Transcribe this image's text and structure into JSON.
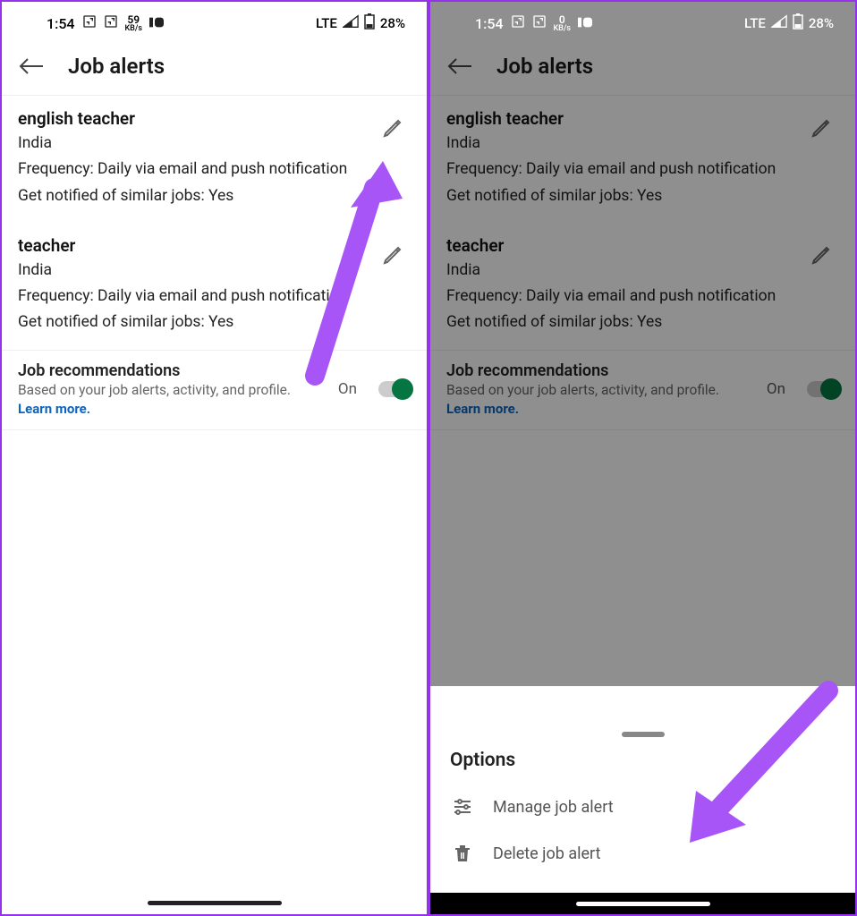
{
  "status": {
    "time": "1:54",
    "kb_left": "59",
    "kb_unit": "KB/s",
    "kb_right": "0",
    "network": "LTE",
    "battery": "28%"
  },
  "header": {
    "title": "Job alerts"
  },
  "alerts": [
    {
      "title": "english teacher",
      "location": "India",
      "frequency": "Frequency: Daily via email and push notification",
      "similar": "Get notified of similar jobs: Yes"
    },
    {
      "title": "teacher",
      "location": "India",
      "frequency": "Frequency: Daily via email and push notification",
      "similar": "Get notified of similar jobs: Yes"
    }
  ],
  "reco": {
    "title": "Job recommendations",
    "sub": "Based on your job alerts, activity, and profile.",
    "link": "Learn more.",
    "state": "On"
  },
  "sheet": {
    "title": "Options",
    "manage": "Manage job alert",
    "delete": "Delete job alert"
  }
}
